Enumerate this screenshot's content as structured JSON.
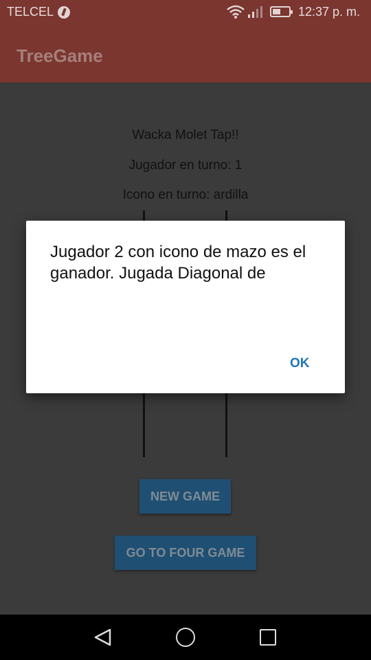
{
  "status_bar": {
    "carrier": "TELCEL",
    "time": "12:37 p. m.",
    "icons": [
      "carrier-status-icon",
      "wifi-icon",
      "signal-icon",
      "battery-icon"
    ]
  },
  "app_bar": {
    "title": "TreeGame"
  },
  "game": {
    "title": "Wacka Molet Tap!!",
    "current_player": "Jugador en turno: 1",
    "current_icon": "Icono en turno: ardilla"
  },
  "buttons": {
    "new_game": "NEW GAME",
    "four_game": "GO TO FOUR GAME"
  },
  "dialog": {
    "message": "Jugador 2 con icono de mazo es el ganador. Jugada Diagonal de",
    "ok": "OK"
  },
  "nav": {
    "icons": [
      "back-icon",
      "home-icon",
      "recents-icon"
    ]
  },
  "colors": {
    "primary_dark": "#7a362f",
    "dim_background": "#3b3b3b",
    "button": "#1f4f72",
    "dialog_action": "#2275b3"
  }
}
